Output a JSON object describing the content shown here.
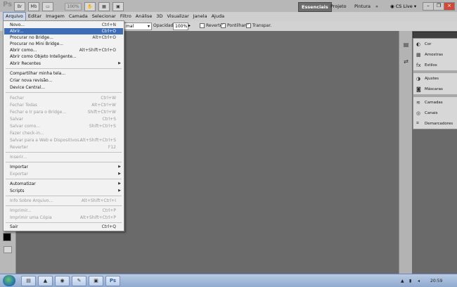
{
  "app": {
    "logo_text": "Ps",
    "zoom_value": "100%"
  },
  "menubar": {
    "items": [
      "Arquivo",
      "Editar",
      "Imagem",
      "Camada",
      "Selecionar",
      "Filtro",
      "Análise",
      "3D",
      "Visualizar",
      "Janela",
      "Ajuda"
    ],
    "active_index": 0
  },
  "workspace": {
    "buttons": [
      "Essenciais",
      "Projeto",
      "Pintura"
    ],
    "active": "Essenciais",
    "more_icon": "»",
    "cs_live_label": "CS Live"
  },
  "window_controls": {
    "minimize": "–",
    "restore": "❐",
    "close": "×"
  },
  "options_bar": {
    "mode_value": "mal",
    "opacity_label": "Opacidade:",
    "opacity_value": "100%",
    "reverse_label": "Reverter",
    "dither_label": "Pontilham.",
    "transparency_label": "Transpar.",
    "reverse_checked": false,
    "dither_checked": true,
    "transparency_checked": true
  },
  "file_menu": {
    "items": [
      {
        "label": "Novo...",
        "shortcut": "Ctrl+N",
        "disabled": false,
        "submenu": false
      },
      {
        "label": "Abrir...",
        "shortcut": "Ctrl+O",
        "disabled": false,
        "submenu": false,
        "highlighted": true
      },
      {
        "label": "Procurar no Bridge...",
        "shortcut": "Alt+Ctrl+O",
        "disabled": false,
        "submenu": false
      },
      {
        "label": "Procurar no Mini Bridge...",
        "shortcut": "",
        "disabled": false,
        "submenu": false
      },
      {
        "label": "Abrir como...",
        "shortcut": "Alt+Shift+Ctrl+O",
        "disabled": false,
        "submenu": false
      },
      {
        "label": "Abrir como Objeto Inteligente...",
        "shortcut": "",
        "disabled": false,
        "submenu": false
      },
      {
        "label": "Abrir Recentes",
        "shortcut": "",
        "disabled": false,
        "submenu": true
      },
      {
        "label": "Compartilhar minha tela...",
        "shortcut": "",
        "disabled": false,
        "submenu": false
      },
      {
        "label": "Criar nova revisão...",
        "shortcut": "",
        "disabled": false,
        "submenu": false
      },
      {
        "label": "Device Central...",
        "shortcut": "",
        "disabled": false,
        "submenu": false
      },
      {
        "label": "Fechar",
        "shortcut": "Ctrl+W",
        "disabled": true,
        "submenu": false
      },
      {
        "label": "Fechar Todas",
        "shortcut": "Alt+Ctrl+W",
        "disabled": true,
        "submenu": false
      },
      {
        "label": "Fechar e Ir para o Bridge...",
        "shortcut": "Shift+Ctrl+W",
        "disabled": true,
        "submenu": false
      },
      {
        "label": "Salvar",
        "shortcut": "Ctrl+S",
        "disabled": true,
        "submenu": false
      },
      {
        "label": "Salvar como...",
        "shortcut": "Shift+Ctrl+S",
        "disabled": true,
        "submenu": false
      },
      {
        "label": "Fazer check-in...",
        "shortcut": "",
        "disabled": true,
        "submenu": false
      },
      {
        "label": "Salvar para a Web e Dispositivos...",
        "shortcut": "Alt+Shift+Ctrl+S",
        "disabled": true,
        "submenu": false
      },
      {
        "label": "Reverter",
        "shortcut": "F12",
        "disabled": true,
        "submenu": false
      },
      {
        "label": "Inserir...",
        "shortcut": "",
        "disabled": true,
        "submenu": false
      },
      {
        "label": "Importar",
        "shortcut": "",
        "disabled": false,
        "submenu": true
      },
      {
        "label": "Exportar",
        "shortcut": "",
        "disabled": true,
        "submenu": true
      },
      {
        "label": "Automatizar",
        "shortcut": "",
        "disabled": false,
        "submenu": true
      },
      {
        "label": "Scripts",
        "shortcut": "",
        "disabled": false,
        "submenu": true
      },
      {
        "label": "Info Sobre Arquivo...",
        "shortcut": "Alt+Shift+Ctrl+I",
        "disabled": true,
        "submenu": false
      },
      {
        "label": "Imprimir...",
        "shortcut": "Ctrl+P",
        "disabled": true,
        "submenu": false
      },
      {
        "label": "Imprimir uma Cópia",
        "shortcut": "Alt+Shift+Ctrl+P",
        "disabled": true,
        "submenu": false
      },
      {
        "label": "Sair",
        "shortcut": "Ctrl+Q",
        "disabled": false,
        "submenu": false
      }
    ]
  },
  "panels": {
    "items": [
      "Cor",
      "Amostras",
      "Estilos",
      "Ajustes",
      "Máscaras",
      "Camadas",
      "Canais",
      "Demarcadores"
    ]
  },
  "taskbar": {
    "clock": "20:59"
  },
  "colors": {
    "highlight": "#3d6db6",
    "workspace_active": "#6d6d6d",
    "canvas": "#6a6a6a"
  }
}
